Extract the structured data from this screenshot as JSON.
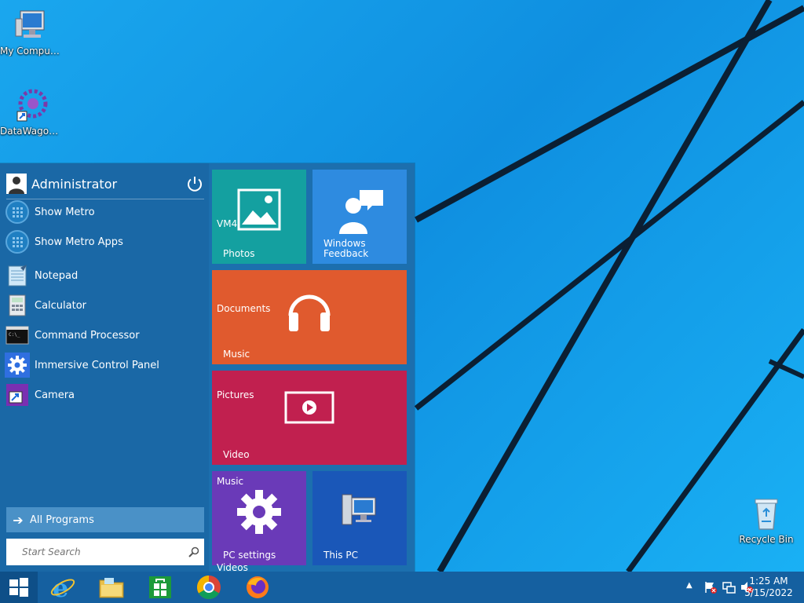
{
  "desktop": {
    "icons": [
      {
        "label": "My Computer"
      },
      {
        "label": "DataWagon..."
      },
      {
        "label": "Recycle Bin"
      }
    ]
  },
  "start_menu": {
    "user": "Administrator",
    "items": [
      {
        "label": "Show Metro"
      },
      {
        "label": "Show Metro Apps"
      },
      {
        "label": "Notepad"
      },
      {
        "label": "Calculator"
      },
      {
        "label": "Command Processor"
      },
      {
        "label": "Immersive Control Panel"
      },
      {
        "label": "Camera"
      }
    ],
    "all_programs": "All Programs",
    "search_placeholder": "Start Search"
  },
  "tiles": {
    "photos": {
      "label": "Photos",
      "top": "VM4",
      "color": "#14a0a0"
    },
    "feedback": {
      "label_1": "Windows",
      "label_2": "Feedback",
      "color": "#2e8be0"
    },
    "music": {
      "label": "Music",
      "top": "Documents",
      "color": "#e05a2e"
    },
    "video": {
      "label": "Video",
      "top": "Pictures",
      "color": "#c1204f"
    },
    "settings": {
      "label": "PC settings",
      "top": "Music",
      "color": "#6a3ab8"
    },
    "thispc": {
      "label": "This PC",
      "color": "#1a57b8"
    },
    "videos_overflow": "Videos"
  },
  "taskbar": {
    "apps": [
      "internet-explorer",
      "file-explorer",
      "store",
      "chrome",
      "firefox"
    ],
    "time": "1:25 AM",
    "date": "5/15/2022"
  }
}
